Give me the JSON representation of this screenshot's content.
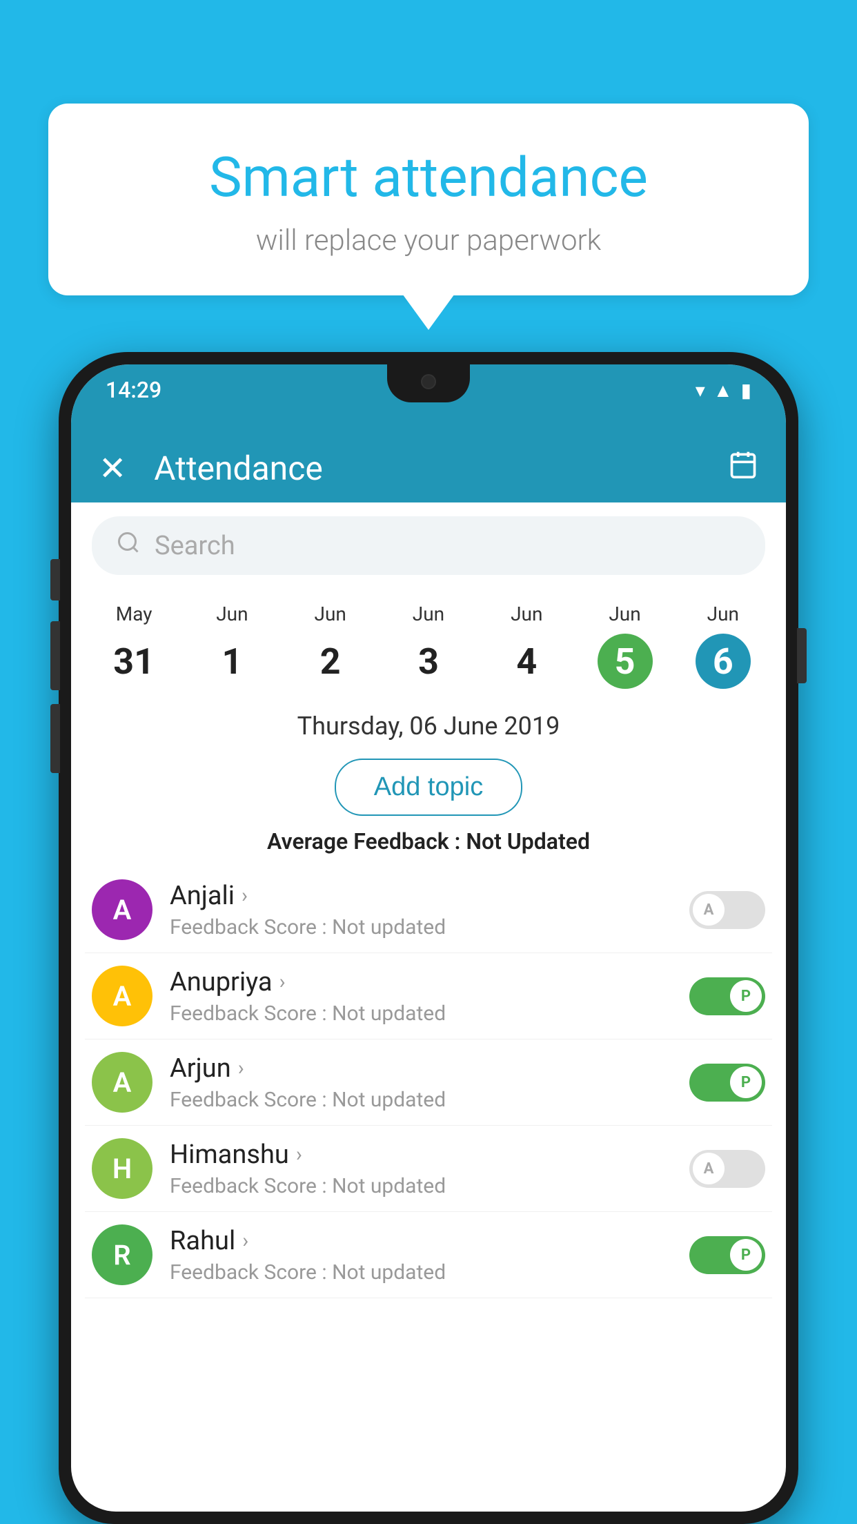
{
  "background_color": "#22b8e8",
  "bubble": {
    "title": "Smart attendance",
    "subtitle": "will replace your paperwork"
  },
  "status_bar": {
    "time": "14:29",
    "icons": [
      "wifi",
      "signal",
      "battery"
    ]
  },
  "app_bar": {
    "title": "Attendance",
    "close_label": "✕",
    "calendar_icon": "📅"
  },
  "search": {
    "placeholder": "Search"
  },
  "calendar": {
    "days": [
      {
        "month": "May",
        "num": "31",
        "state": "normal"
      },
      {
        "month": "Jun",
        "num": "1",
        "state": "normal"
      },
      {
        "month": "Jun",
        "num": "2",
        "state": "normal"
      },
      {
        "month": "Jun",
        "num": "3",
        "state": "normal"
      },
      {
        "month": "Jun",
        "num": "4",
        "state": "normal"
      },
      {
        "month": "Jun",
        "num": "5",
        "state": "today"
      },
      {
        "month": "Jun",
        "num": "6",
        "state": "selected"
      }
    ]
  },
  "selected_date": "Thursday, 06 June 2019",
  "add_topic_label": "Add topic",
  "avg_feedback": {
    "label": "Average Feedback : ",
    "value": "Not Updated"
  },
  "students": [
    {
      "name": "Anjali",
      "avatar_letter": "A",
      "avatar_color": "#9c27b0",
      "feedback": "Feedback Score : Not updated",
      "toggle": "off",
      "toggle_letter": "A"
    },
    {
      "name": "Anupriya",
      "avatar_letter": "A",
      "avatar_color": "#ffc107",
      "feedback": "Feedback Score : Not updated",
      "toggle": "on",
      "toggle_letter": "P"
    },
    {
      "name": "Arjun",
      "avatar_letter": "A",
      "avatar_color": "#8bc34a",
      "feedback": "Feedback Score : Not updated",
      "toggle": "on",
      "toggle_letter": "P"
    },
    {
      "name": "Himanshu",
      "avatar_letter": "H",
      "avatar_color": "#8bc34a",
      "feedback": "Feedback Score : Not updated",
      "toggle": "off",
      "toggle_letter": "A"
    },
    {
      "name": "Rahul",
      "avatar_letter": "R",
      "avatar_color": "#4caf50",
      "feedback": "Feedback Score : Not updated",
      "toggle": "on",
      "toggle_letter": "P"
    }
  ]
}
